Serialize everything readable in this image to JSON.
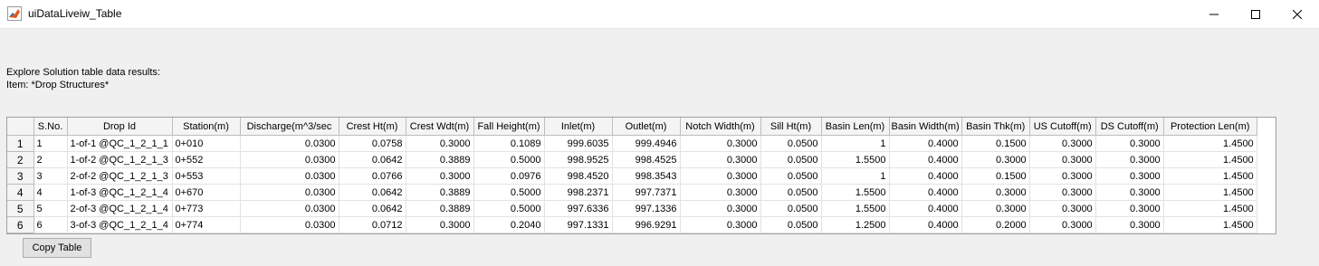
{
  "window": {
    "title": "uiDataLiveiw_Table",
    "controls": [
      "minimize",
      "maximize",
      "close"
    ]
  },
  "description": {
    "line1": "Explore Solution table data results:",
    "line2": "Item: *Drop Structures*"
  },
  "table": {
    "columns": [
      "S.No.",
      "Drop Id",
      "Station(m)",
      "Discharge(m^3/sec",
      "Crest Ht(m)",
      "Crest Wdt(m)",
      "Fall Height(m)",
      "Inlet(m)",
      "Outlet(m)",
      "Notch Width(m)",
      "Sill Ht(m)",
      "Basin Len(m)",
      "Basin Width(m)",
      "Basin Thk(m)",
      "US Cutoff(m)",
      "DS Cutoff(m)",
      "Protection Len(m)"
    ],
    "row_headers": [
      "1",
      "2",
      "3",
      "4",
      "5",
      "6"
    ],
    "rows": [
      [
        "1",
        "1-of-1 @QC_1_2_1_1",
        "0+010",
        "0.0300",
        "0.0758",
        "0.3000",
        "0.1089",
        "999.6035",
        "999.4946",
        "0.3000",
        "0.0500",
        "1",
        "0.4000",
        "0.1500",
        "0.3000",
        "0.3000",
        "1.4500"
      ],
      [
        "2",
        "1-of-2 @QC_1_2_1_3",
        "0+552",
        "0.0300",
        "0.0642",
        "0.3889",
        "0.5000",
        "998.9525",
        "998.4525",
        "0.3000",
        "0.0500",
        "1.5500",
        "0.4000",
        "0.3000",
        "0.3000",
        "0.3000",
        "1.4500"
      ],
      [
        "3",
        "2-of-2 @QC_1_2_1_3",
        "0+553",
        "0.0300",
        "0.0766",
        "0.3000",
        "0.0976",
        "998.4520",
        "998.3543",
        "0.3000",
        "0.0500",
        "1",
        "0.4000",
        "0.1500",
        "0.3000",
        "0.3000",
        "1.4500"
      ],
      [
        "4",
        "1-of-3 @QC_1_2_1_4",
        "0+670",
        "0.0300",
        "0.0642",
        "0.3889",
        "0.5000",
        "998.2371",
        "997.7371",
        "0.3000",
        "0.0500",
        "1.5500",
        "0.4000",
        "0.3000",
        "0.3000",
        "0.3000",
        "1.4500"
      ],
      [
        "5",
        "2-of-3 @QC_1_2_1_4",
        "0+773",
        "0.0300",
        "0.0642",
        "0.3889",
        "0.5000",
        "997.6336",
        "997.1336",
        "0.3000",
        "0.0500",
        "1.5500",
        "0.4000",
        "0.3000",
        "0.3000",
        "0.3000",
        "1.4500"
      ],
      [
        "6",
        "3-of-3 @QC_1_2_1_4",
        "0+774",
        "0.0300",
        "0.0712",
        "0.3000",
        "0.2040",
        "997.1331",
        "996.9291",
        "0.3000",
        "0.0500",
        "1.2500",
        "0.4000",
        "0.2000",
        "0.3000",
        "0.3000",
        "1.4500"
      ]
    ]
  },
  "buttons": {
    "copy_table": "Copy Table"
  },
  "colors": {
    "window_bg": "#f0f0f0",
    "titlebar_bg": "#ffffff",
    "table_bg": "#ffffff",
    "header_bg": "#f4f4f4"
  }
}
